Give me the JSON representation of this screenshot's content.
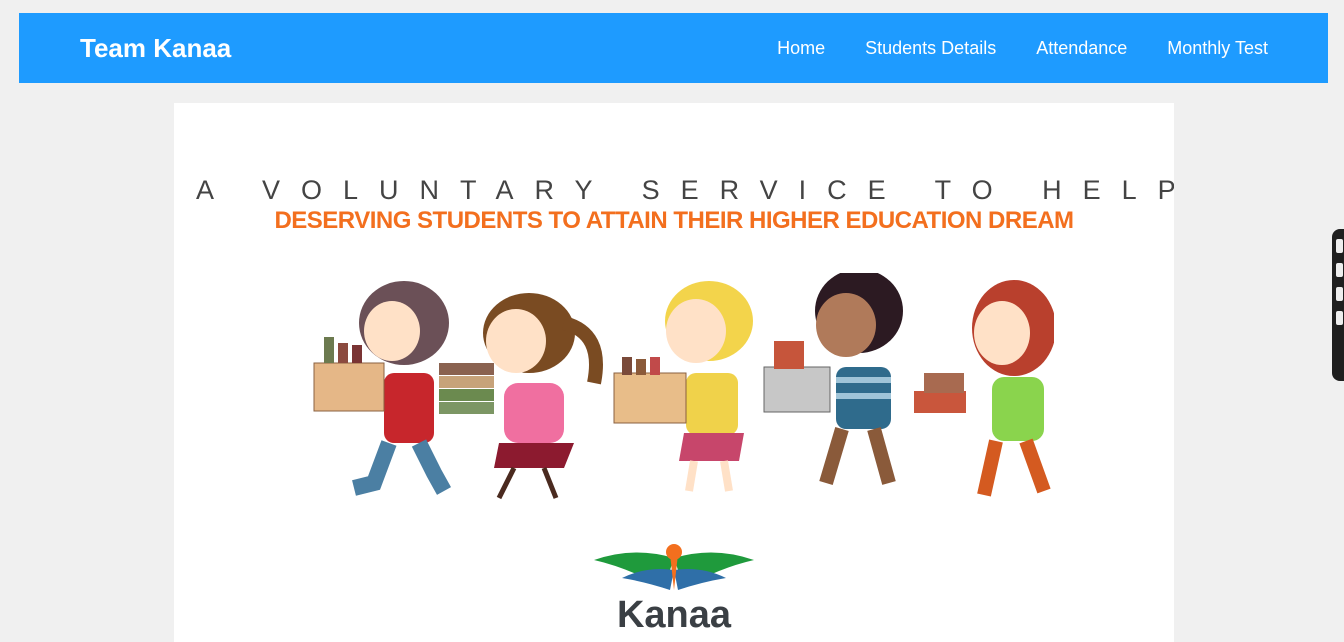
{
  "navbar": {
    "brand": "Team Kanaa",
    "links": [
      "Home",
      "Students Details",
      "Attendance",
      "Monthly Test"
    ]
  },
  "hero": {
    "tagline_top": "A VOLUNTARY SERVICE TO HELP",
    "tagline_bottom": "DESERVING STUDENTS TO ATTAIN THEIR HIGHER EDUCATION DREAM",
    "logo_text": "Kanaa"
  },
  "colors": {
    "navbar": "#1e9bff",
    "tagline_accent": "#f36f1e"
  }
}
